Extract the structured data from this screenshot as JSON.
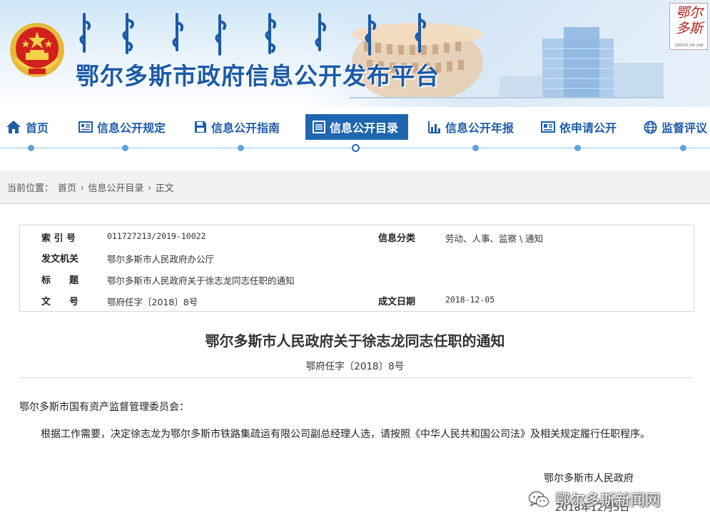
{
  "banner": {
    "title": "鄂尔多斯市政府信息公开发布平台",
    "logo_text": "鄂尔多斯",
    "logo_sub": "ORDOS ON LINE"
  },
  "nav": {
    "items": [
      {
        "label": "首页",
        "icon": "home-icon"
      },
      {
        "label": "信息公开规定",
        "icon": "document-icon"
      },
      {
        "label": "信息公开指南",
        "icon": "save-icon"
      },
      {
        "label": "信息公开目录",
        "icon": "list-icon",
        "active": true
      },
      {
        "label": "信息公开年报",
        "icon": "bar-chart-icon"
      },
      {
        "label": "依申请公开",
        "icon": "card-icon"
      },
      {
        "label": "监督评议",
        "icon": "globe-icon"
      }
    ],
    "active_color": "#1f66b0",
    "text_color": "#1f5da9"
  },
  "breadcrumb": {
    "prefix": "当前位置：",
    "items": [
      "首页",
      "信息公开目录",
      "正文"
    ]
  },
  "info": {
    "index_label": "索 引 号",
    "index_value": "011727213/2019-10022",
    "category_label": "信息分类",
    "category_value": "劳动、人事、监察 \\ 通知",
    "issuer_label": "发文机关",
    "issuer_value": "鄂尔多斯市人民政府办公厅",
    "title_label": "标　　题",
    "title_value": "鄂尔多斯市人民政府关于徐志龙同志任职的通知",
    "docno_label": "文　　号",
    "docno_value": "鄂府任字〔2018〕8号",
    "date_label": "成文日期",
    "date_value": "2018-12-05"
  },
  "document": {
    "title": "鄂尔多斯市人民政府关于徐志龙同志任职的通知",
    "subtitle": "鄂府任字〔2018〕8号",
    "addressee": "鄂尔多斯市国有资产监督管理委员会：",
    "body": "根据工作需要，决定徐志龙为鄂尔多斯市铁路集疏运有限公司副总经理人选，请按照《中华人民共和国公司法》及相关规定履行任职程序。",
    "signature": "鄂尔多斯市人民政府",
    "date": "2018年12月5日"
  },
  "watermark": {
    "text": "鄂尔多斯新闻网",
    "icon": "wechat-icon"
  }
}
